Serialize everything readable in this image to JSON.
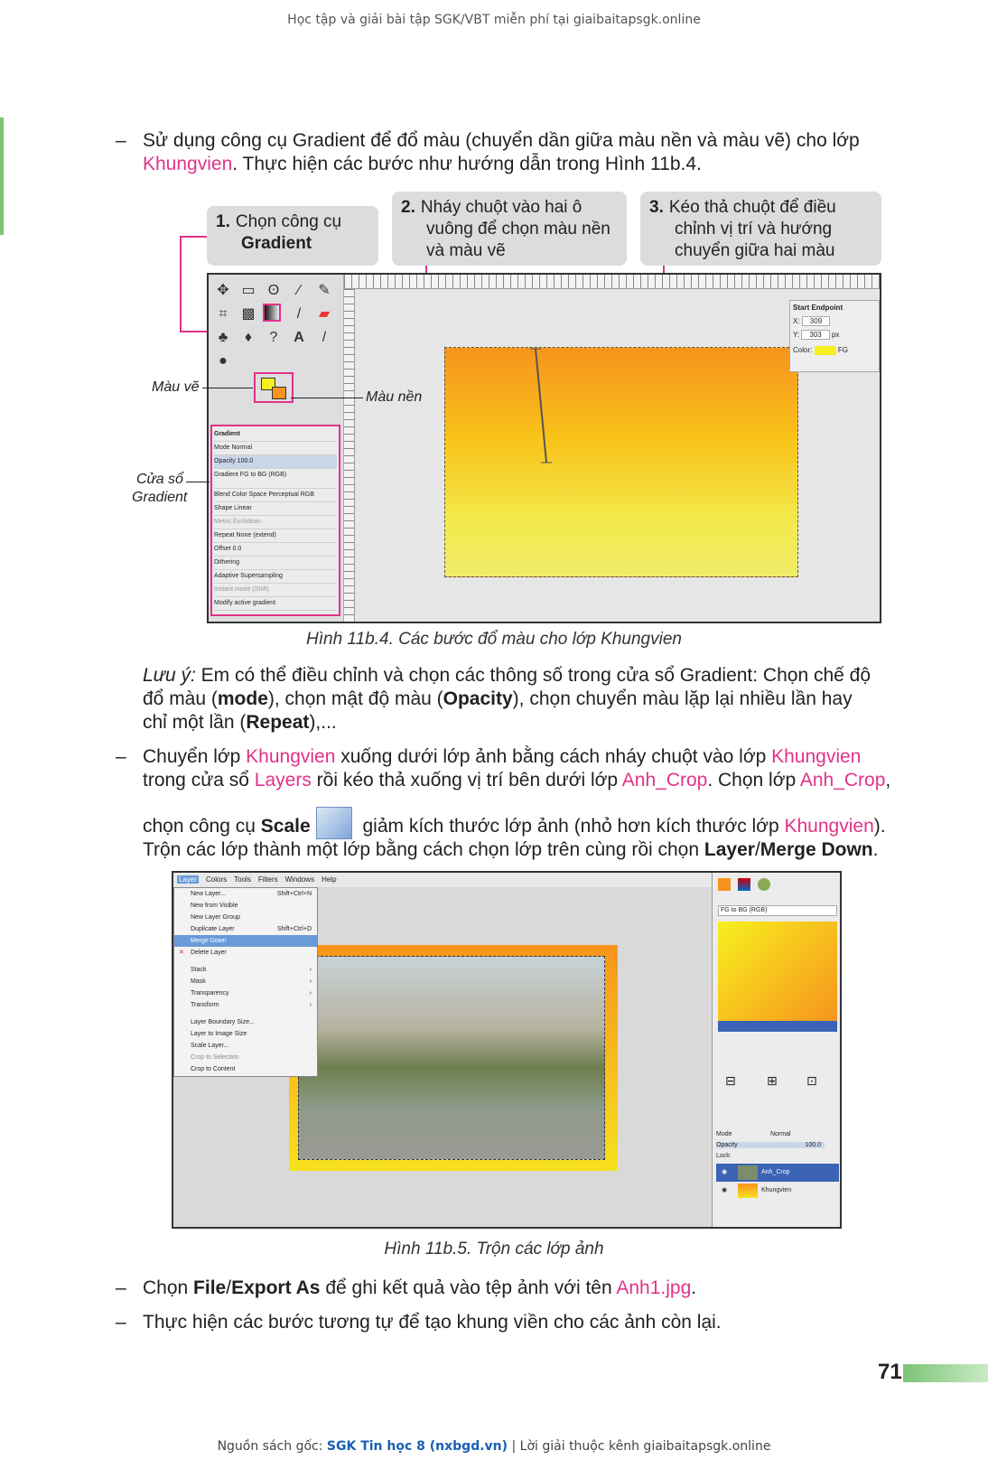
{
  "header": "Học tập và giải bài tập SGK/VBT miễn phí tại giaibaitapsgk.online",
  "dash": "–",
  "para1": {
    "l1": "Sử dụng công cụ Gradient để đổ màu (chuyển dần giữa màu nền và màu vẽ) cho lớp",
    "k1": "Khungvien",
    "l2": ". Thực hiện các bước như hướng dẫn trong Hình 11b.4."
  },
  "callouts": {
    "c1_num": "1.",
    "c1_text": "Chọn công cụ",
    "c1_bold": "Gradient",
    "c2_num": "2.",
    "c2_text1": "Nháy chuột vào hai ô",
    "c2_text2": "vuông để chọn màu nền",
    "c2_text3": "và màu vẽ",
    "c3_num": "3.",
    "c3_text1": "Kéo thả chuột để điều",
    "c3_text2": "chỉnh vị trí và hướng",
    "c3_text3": "chuyển giữa hai màu"
  },
  "labels": {
    "mau_ve": "Màu vẽ",
    "mau_nen": "Màu nền",
    "cua_so1": "Cửa sổ",
    "cua_so2": "Gradient"
  },
  "shot1": {
    "endpoint_title": "Start Endpoint",
    "x_label": "X:",
    "x_val": "309",
    "y_label": "Y:",
    "y_val": "303",
    "unit": "px",
    "color_label": "Color:",
    "color_val": "FG",
    "panel_title": "Gradient",
    "rows": [
      "Mode            Normal",
      "Opacity                  100.0",
      "Gradient  FG to BG (RGB)",
      "Blend Color Space   Perceptual RGB",
      "Shape                    Linear",
      "Metric                Euclidean",
      "Repeat            None (extend)",
      "Offset                        0.0",
      "Dithering",
      "Adaptive Supersampling",
      "Instant mode (Shift)",
      "Modify active gradient"
    ]
  },
  "caption1": "Hình 11b.4. Các bước đổ màu cho lớp Khungvien",
  "note": {
    "lead": "Lưu ý:",
    "t1": " Em có thể điều chỉnh và chọn các thông số trong cửa sổ Gradient: Chọn chế độ",
    "t2a": "đổ màu (",
    "mode": "mode",
    "t2b": "), chọn mật độ màu (",
    "opacity": "Opacity",
    "t2c": "), chọn chuyển màu lặp lại nhiều lần hay",
    "t3a": "chỉ một lần (",
    "repeat": "Repeat",
    "t3b": "),..."
  },
  "para2": {
    "a1": "Chuyển lớp ",
    "k1": "Khungvien",
    "a2": " xuống dưới lớp ảnh bằng cách nháy chuột vào lớp ",
    "k2": "Khungvien",
    "b1": "trong cửa sổ ",
    "k3": "Layers",
    "b2": " rồi kéo thả xuống vị trí bên dưới lớp ",
    "k4": "Anh_Crop",
    "b3": ". Chọn lớp ",
    "k5": "Anh_Crop",
    "b4": ",",
    "c1": "chọn công cụ ",
    "scale": "Scale",
    "c2": " giảm kích thước lớp ảnh (nhỏ hơn kích thước lớp ",
    "k6": "Khungvien",
    "c3": ").",
    "d1": "Trộn các lớp thành một lớp bằng cách chọn lớp trên cùng rồi chọn ",
    "layer": "Layer",
    "slash": "/",
    "merge": "Merge Down",
    "d2": "."
  },
  "shot2": {
    "menubar": [
      "Layer",
      "Colors",
      "Tools",
      "Filters",
      "Windows",
      "Help"
    ],
    "menu": [
      {
        "label": "New Layer...",
        "shortcut": "Shift+Ctrl+N"
      },
      {
        "label": "New from Visible",
        "shortcut": ""
      },
      {
        "label": "New Layer Group",
        "shortcut": ""
      },
      {
        "label": "Duplicate Layer",
        "shortcut": "Shift+Ctrl+D"
      },
      {
        "label": "Merge Down",
        "shortcut": ""
      },
      {
        "label": "Delete Layer",
        "shortcut": ""
      },
      {
        "label": "Stack",
        "shortcut": "›"
      },
      {
        "label": "Mask",
        "shortcut": "›"
      },
      {
        "label": "Transparency",
        "shortcut": "›"
      },
      {
        "label": "Transform",
        "shortcut": "›"
      },
      {
        "label": "Layer Boundary Size...",
        "shortcut": ""
      },
      {
        "label": "Layer to Image Size",
        "shortcut": ""
      },
      {
        "label": "Scale Layer...",
        "shortcut": ""
      },
      {
        "label": "Crop to Selection",
        "shortcut": ""
      },
      {
        "label": "Crop to Content",
        "shortcut": ""
      }
    ],
    "grad_name": "FG to BG (RGB)",
    "mode_label": "Mode",
    "mode_val": "Normal",
    "opacity_label": "Opacity",
    "opacity_val": "100.0",
    "lock_label": "Lock:",
    "layer1": "Anh_Crop",
    "layer2": "Khungvien"
  },
  "caption2": "Hình 11b.5. Trộn các lớp ảnh",
  "para3": {
    "a": "Chọn ",
    "file": "File",
    "slash": "/",
    "export": "Export As",
    "b": " để ghi kết quả vào tệp ảnh với tên ",
    "k": "Anh1.jpg",
    "c": "."
  },
  "para4": "Thực hiện các bước tương tự để tạo khung viền cho các ảnh còn lại.",
  "page_number": "71",
  "footer": {
    "a": "Nguồn sách gốc: ",
    "b": "SGK Tin học 8 (nxbgd.vn)",
    "c": " | Lời giải thuộc kênh giaibaitapsgk.online"
  }
}
